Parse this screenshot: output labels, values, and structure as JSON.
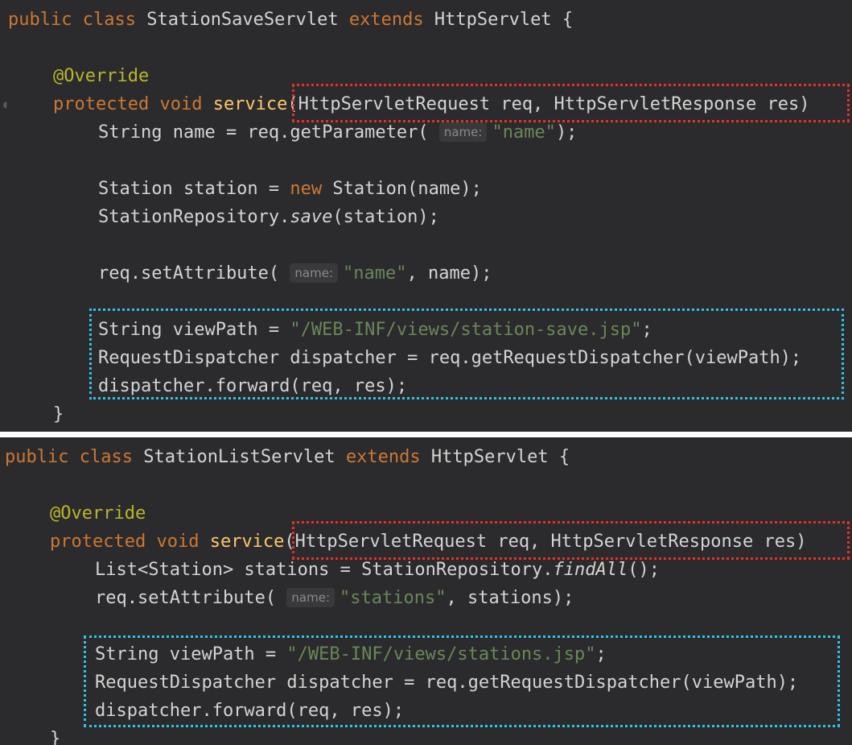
{
  "top_snippet": {
    "class_line": {
      "kw1": "public",
      "kw2": "class",
      "name": "StationSaveServlet",
      "kw3": "extends",
      "parent": "HttpServlet",
      "brace": "{"
    },
    "annotation": "@Override",
    "method": {
      "kw1": "protected",
      "kw2": "void",
      "name": "service",
      "params": "(HttpServletRequest req, HttpServletResponse res)"
    },
    "line_name": {
      "pre": "String name = req.getParameter(",
      "hint": "name:",
      "str": "\"name\"",
      "post": ");"
    },
    "line_station": {
      "pre": "Station station = ",
      "kw": "new",
      "post": " Station(name);"
    },
    "line_save": {
      "pre": "StationRepository.",
      "method": "save",
      "post": "(station);"
    },
    "line_setattr": {
      "pre": "req.setAttribute(",
      "hint": "name:",
      "str": "\"name\"",
      "post": ", name);"
    },
    "line_viewpath": {
      "pre": "String viewPath = ",
      "str": "\"/WEB-INF/views/station-save.jsp\"",
      "post": ";"
    },
    "line_dispatcher": "RequestDispatcher dispatcher = req.getRequestDispatcher(viewPath);",
    "line_forward": "dispatcher.forward(req, res);",
    "closing": "}"
  },
  "bottom_snippet": {
    "class_line": {
      "kw1": "public",
      "kw2": "class",
      "name": "StationListServlet",
      "kw3": "extends",
      "parent": "HttpServlet",
      "brace": "{"
    },
    "annotation": "@Override",
    "method": {
      "kw1": "protected",
      "kw2": "void",
      "name": "service",
      "params": "(HttpServletRequest req, HttpServletResponse res)"
    },
    "line_list": {
      "pre": "List<Station> stations = StationRepository.",
      "method": "findAll",
      "post": "();"
    },
    "line_setattr": {
      "pre": "req.setAttribute(",
      "hint": "name:",
      "str": "\"stations\"",
      "post": ", stations);"
    },
    "line_viewpath": {
      "pre": "String viewPath = ",
      "str": "\"/WEB-INF/views/stations.jsp\"",
      "post": ";"
    },
    "line_dispatcher": "RequestDispatcher dispatcher = req.getRequestDispatcher(viewPath);",
    "line_forward": "dispatcher.forward(req, res);",
    "closing": "}"
  },
  "colors": {
    "background": "#2b2b2d",
    "keyword": "#cc7832",
    "annotation": "#bbb529",
    "method": "#ffc66d",
    "string": "#6a8759",
    "red_highlight": "#e8302a",
    "cyan_highlight": "#2ec4e6"
  }
}
